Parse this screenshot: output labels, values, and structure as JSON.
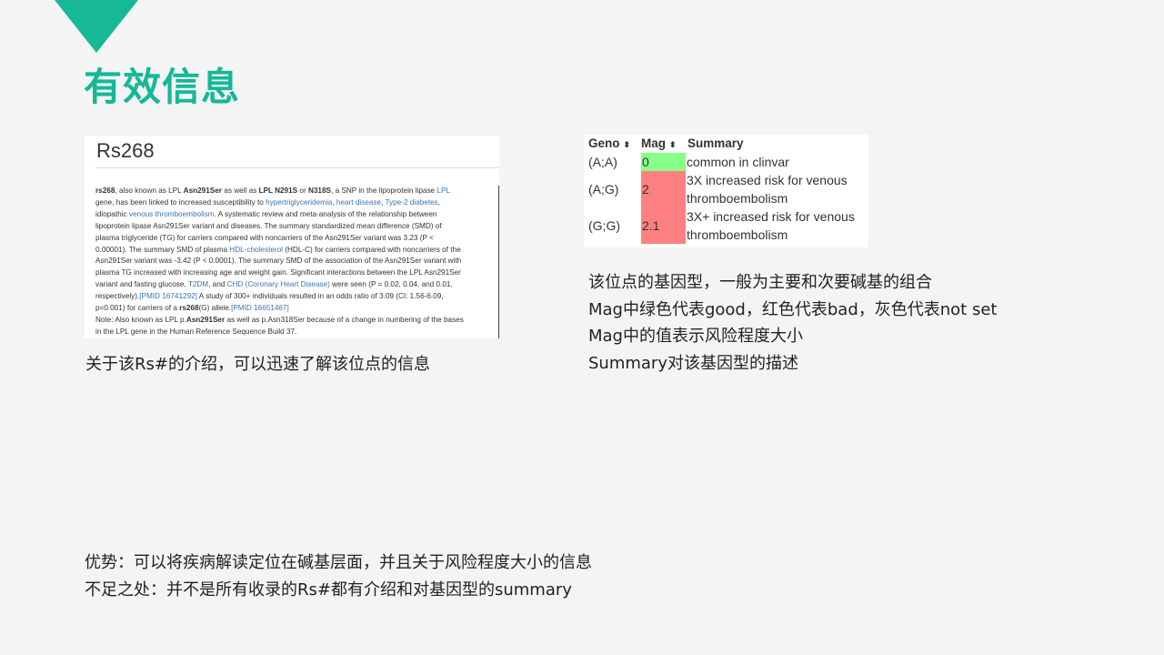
{
  "slide": {
    "title": "有效信息",
    "accent_color": "#16b896"
  },
  "snp_panel": {
    "title": "Rs268",
    "body": [
      [
        {
          "t": "rs268",
          "b": true
        },
        {
          "t": ", also known as LPL "
        },
        {
          "t": "Asn291Ser",
          "b": true
        },
        {
          "t": " as well as "
        },
        {
          "t": "LPL N291S",
          "b": true
        },
        {
          "t": " or "
        },
        {
          "t": "N318S",
          "b": true
        },
        {
          "t": ", a SNP in the lipoprotein lipase "
        },
        {
          "t": "LPL",
          "l": true
        }
      ],
      [
        {
          "t": "gene, has been linked to increased susceptibility to "
        },
        {
          "t": "hypertriglyceridemia",
          "l": true
        },
        {
          "t": ", "
        },
        {
          "t": "heart disease",
          "l": true
        },
        {
          "t": ", "
        },
        {
          "t": "Type-2 diabetes",
          "l": true
        },
        {
          "t": ","
        }
      ],
      [
        {
          "t": "idiopathic "
        },
        {
          "t": "venous thromboembolism",
          "l": true
        },
        {
          "t": ". A systematic review and meta-analysis of the relationship between"
        }
      ],
      [
        {
          "t": "lipoprotein lipase Asn291Ser variant and diseases. The summary standardized mean difference (SMD) of"
        }
      ],
      [
        {
          "t": "plasma triglyceride (TG) for carriers compared with noncarriers of the Asn291Ser variant was 3.23 (P <"
        }
      ],
      [
        {
          "t": "0.00001). The summary SMD of plasma "
        },
        {
          "t": "HDL-cholesterol",
          "l": true
        },
        {
          "t": " (HDL-C) for carriers compared with noncarriers of the"
        }
      ],
      [
        {
          "t": "Asn291Ser variant was -3.42 (P < 0.0001). The summary SMD of the association of the Asn291Ser variant with"
        }
      ],
      [
        {
          "t": "plasma TG increased with increasing age and weight gain. Significant interactions between the LPL Asn291Ser"
        }
      ],
      [
        {
          "t": "variant and fasting glucose, "
        },
        {
          "t": "T2DM",
          "l": true
        },
        {
          "t": ", and "
        },
        {
          "t": "CHD (Coronary Heart Disease)",
          "l": true
        },
        {
          "t": " were seen (P = 0.02, 0.04, and 0.01,"
        }
      ],
      [
        {
          "t": "respectively)."
        },
        {
          "t": "[PMID 16741292]",
          "l": true
        },
        {
          "t": " A study of 300+ individuals resulted in an odds ratio of 3.09 (CI: 1.56-6.09,"
        }
      ],
      [
        {
          "t": "p=0.001) for carriers of a "
        },
        {
          "t": "rs268",
          "b": true
        },
        {
          "t": "(G) allele."
        },
        {
          "t": "[PMID 16651467]",
          "l": true
        }
      ],
      [
        {
          "t": "Note: Also known as LPL p."
        },
        {
          "t": "Asn291Ser",
          "b": true
        },
        {
          "t": " as well as p.Asn318Ser because of a change in numbering of the bases"
        }
      ],
      [
        {
          "t": "in the LPL gene in the Human Reference Sequence Build 37."
        }
      ]
    ]
  },
  "left_caption": "关于该Rs#的介绍，可以迅速了解该位点的信息",
  "geno_table": {
    "headers": [
      "Geno",
      "Mag",
      "Summary"
    ],
    "sort_icon": "⬍",
    "rows": [
      {
        "geno": "(A;A)",
        "mag": "0",
        "summary_lines": [
          "common in clinvar"
        ],
        "color": "#88ff88"
      },
      {
        "geno": "(A;G)",
        "mag": "2",
        "summary_lines": [
          "3X increased risk for venous",
          "thromboembolism"
        ],
        "color": "#ff8080"
      },
      {
        "geno": "(G;G)",
        "mag": "2.1",
        "summary_lines": [
          "3X+ increased risk for venous",
          "thromboembolism"
        ],
        "color": "#ff8080"
      }
    ]
  },
  "right_description": [
    "该位点的基因型，一般为主要和次要碱基的组合",
    "Mag中绿色代表good，红色代表bad，灰色代表not set",
    "Mag中的值表示风险程度大小",
    "Summary对该基因型的描述"
  ],
  "bottom_notes": [
    "优势：可以将疾病解读定位在碱基层面，并且关于风险程度大小的信息",
    "不足之处：并不是所有收录的Rs#都有介绍和对基因型的summary"
  ]
}
